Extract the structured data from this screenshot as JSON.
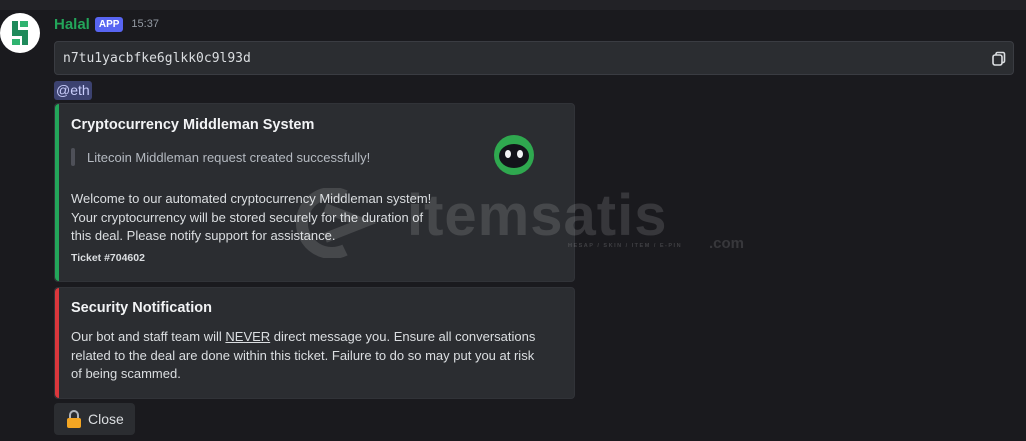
{
  "message": {
    "author": "Halal",
    "badge": "APP",
    "timestamp": "15:37",
    "code_block": "n7tu1yacbfke6glkk0c9l93d",
    "mention": "@eth"
  },
  "embeds": [
    {
      "accent_color": "#23a55a",
      "title": "Cryptocurrency Middleman System",
      "quote": "Litecoin Middleman request created successfully!",
      "description_lines": [
        "Welcome to our automated cryptocurrency Middleman system!",
        "Your cryptocurrency will be stored securely for the duration of",
        "this deal. Please notify support for assistance."
      ],
      "footer": "Ticket #704602"
    },
    {
      "accent_color": "#da373c",
      "title": "Security Notification",
      "description": {
        "line1_before": "Our bot and staff team will ",
        "line1_emphasis": "NEVER",
        "line1_after": " direct message you. Ensure all conversations",
        "line2": "related to the deal are done within this ticket. Failure to do so may put you at risk",
        "line3": "of being scammed."
      }
    }
  ],
  "buttons": {
    "close_label": "Close",
    "close_icon": "lock-icon"
  },
  "watermark": {
    "word": "itemsatis",
    "tagline": "HESAP / SKIN / ITEM / E-PIN",
    "suffix": ".com"
  },
  "icons": {
    "copy": "copy-icon",
    "avatar_logo": "halal-s-logo-icon",
    "thumbnail": "robot-face-icon"
  },
  "colors": {
    "author": "#23a55a",
    "badge": "#5865f2",
    "mention_bg": "#3c4270",
    "embed_bg": "#2b2d31",
    "background": "#1a1a1e"
  }
}
